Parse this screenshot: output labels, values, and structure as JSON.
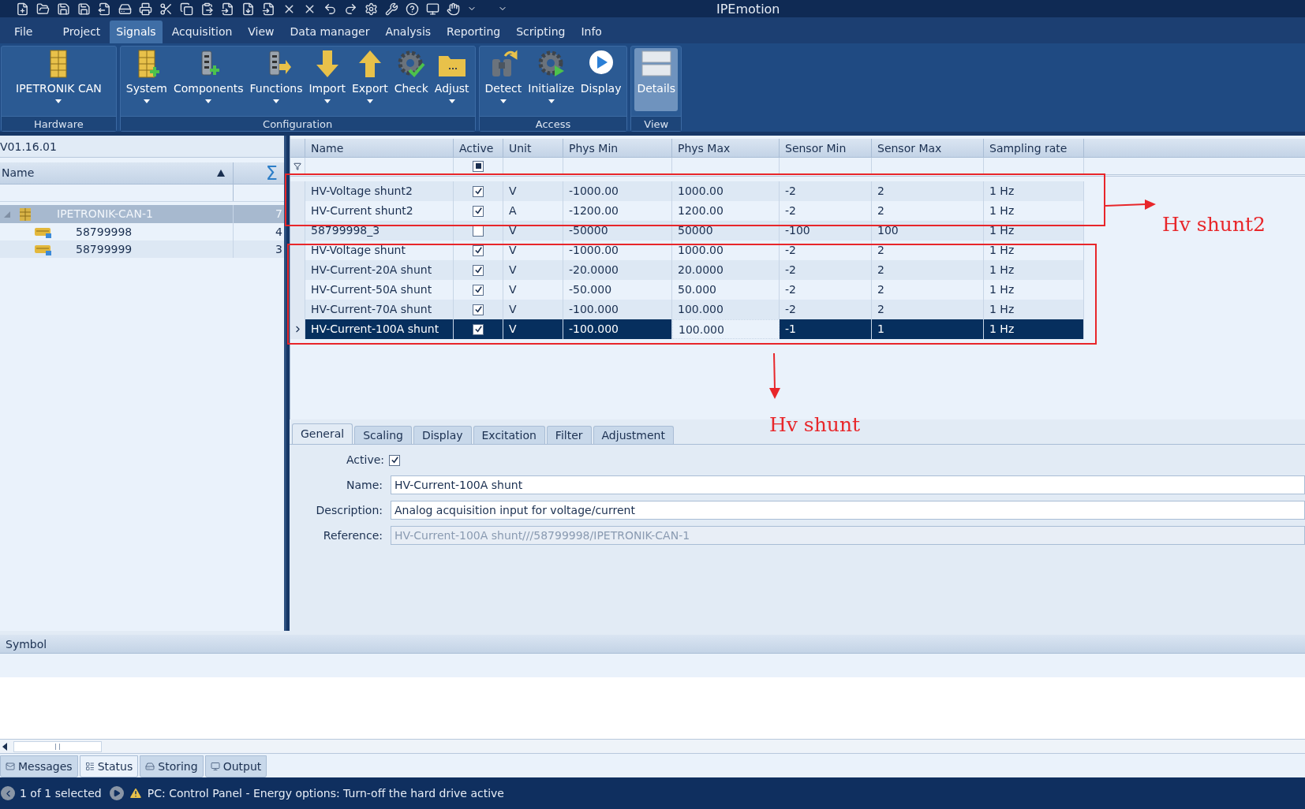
{
  "window": {
    "title": "IPEmotion"
  },
  "menu": [
    {
      "label": "File",
      "selected": false
    },
    {
      "label": "Project",
      "selected": false
    },
    {
      "label": "Signals",
      "selected": true
    },
    {
      "label": "Acquisition",
      "selected": false
    },
    {
      "label": "View",
      "selected": false
    },
    {
      "label": "Data manager",
      "selected": false
    },
    {
      "label": "Analysis",
      "selected": false
    },
    {
      "label": "Reporting",
      "selected": false
    },
    {
      "label": "Scripting",
      "selected": false
    },
    {
      "label": "Info",
      "selected": false
    }
  ],
  "ribbon": {
    "groups": [
      {
        "label": "Hardware",
        "buttons": [
          {
            "label": "IPETRONIK CAN",
            "kind": "rack",
            "dropdown": true,
            "selected": false
          }
        ]
      },
      {
        "label": "Configuration",
        "buttons": [
          {
            "label": "System",
            "kind": "rack-plus",
            "dropdown": true,
            "selected": false
          },
          {
            "label": "Components",
            "kind": "module-plus",
            "dropdown": true,
            "selected": false
          },
          {
            "label": "Functions",
            "kind": "module-arrow",
            "dropdown": true,
            "selected": false
          },
          {
            "label": "Import",
            "kind": "arrow-down",
            "dropdown": true,
            "selected": false
          },
          {
            "label": "Export",
            "kind": "arrow-up",
            "dropdown": true,
            "selected": false
          },
          {
            "label": "Check",
            "kind": "gear-check",
            "dropdown": false,
            "selected": false
          },
          {
            "label": "Adjust",
            "kind": "folder",
            "dropdown": true,
            "selected": false
          }
        ]
      },
      {
        "label": "Access",
        "buttons": [
          {
            "label": "Detect",
            "kind": "binoculars",
            "dropdown": true,
            "selected": false
          },
          {
            "label": "Initialize",
            "kind": "gear-play",
            "dropdown": true,
            "selected": false
          },
          {
            "label": "Display",
            "kind": "play",
            "dropdown": false,
            "selected": false
          }
        ]
      },
      {
        "label": "View",
        "buttons": [
          {
            "label": "Details",
            "kind": "panels",
            "dropdown": false,
            "selected": true
          }
        ]
      }
    ]
  },
  "left_panel": {
    "version": "V01.16.01",
    "columns": [
      "Name",
      "Σ"
    ],
    "tree": [
      {
        "name": "IPETRONIK-CAN-1",
        "count": "7",
        "selected": true,
        "expanded": true,
        "children": [
          {
            "name": "58799998",
            "count": "4",
            "selected": false
          },
          {
            "name": "58799999",
            "count": "3",
            "selected": false
          }
        ]
      }
    ]
  },
  "grid": {
    "columns": [
      {
        "label": "Name",
        "focused": false
      },
      {
        "label": "Active",
        "focused": false
      },
      {
        "label": "Unit",
        "focused": false
      },
      {
        "label": "Phys Min",
        "focused": false
      },
      {
        "label": "Phys Max",
        "focused": true
      },
      {
        "label": "Sensor Min",
        "focused": false
      },
      {
        "label": "Sensor Max",
        "focused": false
      },
      {
        "label": "Sampling rate",
        "focused": false
      }
    ],
    "filter_active": {
      "indeterminate": true
    },
    "rows": [
      {
        "name": "HV-Voltage shunt2",
        "active": true,
        "unit": "V",
        "phys_min": "-1000.00",
        "phys_max": "1000.00",
        "sensor_min": "-2",
        "sensor_max": "2",
        "sampling_rate": "1 Hz",
        "selected": false
      },
      {
        "name": "HV-Current shunt2",
        "active": true,
        "unit": "A",
        "phys_min": "-1200.00",
        "phys_max": "1200.00",
        "sensor_min": "-2",
        "sensor_max": "2",
        "sampling_rate": "1 Hz",
        "selected": false
      },
      {
        "name": "58799998_3",
        "active": false,
        "unit": "V",
        "phys_min": "-50000",
        "phys_max": "50000",
        "sensor_min": "-100",
        "sensor_max": "100",
        "sampling_rate": "1 Hz",
        "selected": false
      },
      {
        "name": "HV-Voltage shunt",
        "active": true,
        "unit": "V",
        "phys_min": "-1000.00",
        "phys_max": "1000.00",
        "sensor_min": "-2",
        "sensor_max": "2",
        "sampling_rate": "1 Hz",
        "selected": false
      },
      {
        "name": "HV-Current-20A shunt",
        "active": true,
        "unit": "V",
        "phys_min": "-20.0000",
        "phys_max": "20.0000",
        "sensor_min": "-2",
        "sensor_max": "2",
        "sampling_rate": "1 Hz",
        "selected": false
      },
      {
        "name": "HV-Current-50A shunt",
        "active": true,
        "unit": "V",
        "phys_min": "-50.000",
        "phys_max": "50.000",
        "sensor_min": "-2",
        "sensor_max": "2",
        "sampling_rate": "1 Hz",
        "selected": false
      },
      {
        "name": "HV-Current-70A shunt",
        "active": true,
        "unit": "V",
        "phys_min": "-100.000",
        "phys_max": "100.000",
        "sensor_min": "-2",
        "sensor_max": "2",
        "sampling_rate": "1 Hz",
        "selected": false
      },
      {
        "name": "HV-Current-100A shunt",
        "active": true,
        "unit": "V",
        "phys_min": "-100.000",
        "phys_max": "100.000",
        "sensor_min": "-1",
        "sensor_max": "1",
        "sampling_rate": "1 Hz",
        "selected": true
      }
    ]
  },
  "detail_tabs": [
    {
      "label": "General",
      "selected": true
    },
    {
      "label": "Scaling",
      "selected": false
    },
    {
      "label": "Display",
      "selected": false
    },
    {
      "label": "Excitation",
      "selected": false
    },
    {
      "label": "Filter",
      "selected": false
    },
    {
      "label": "Adjustment",
      "selected": false
    }
  ],
  "form": {
    "active": {
      "label": "Active:",
      "checked": true
    },
    "fields": [
      {
        "label": "Name:",
        "value": "HV-Current-100A shunt",
        "disabled": false
      },
      {
        "label": "Description:",
        "value": "Analog acquisition input for voltage/current",
        "disabled": false
      },
      {
        "label": "Reference:",
        "value": "HV-Current-100A shunt///58799998/IPETRONIK-CAN-1",
        "disabled": true
      }
    ]
  },
  "symbol_panel": {
    "header": "Symbol"
  },
  "bottom_tabs": [
    {
      "label": "Messages",
      "selected": false
    },
    {
      "label": "Status",
      "selected": true
    },
    {
      "label": "Storing",
      "selected": false
    },
    {
      "label": "Output",
      "selected": false
    }
  ],
  "status_bar": {
    "selection": "1 of 1 selected",
    "message": "PC: Control Panel - Energy options: Turn-off the hard drive active"
  },
  "annotations": [
    {
      "label": "Hv shunt2"
    },
    {
      "label": "Hv shunt"
    }
  ]
}
